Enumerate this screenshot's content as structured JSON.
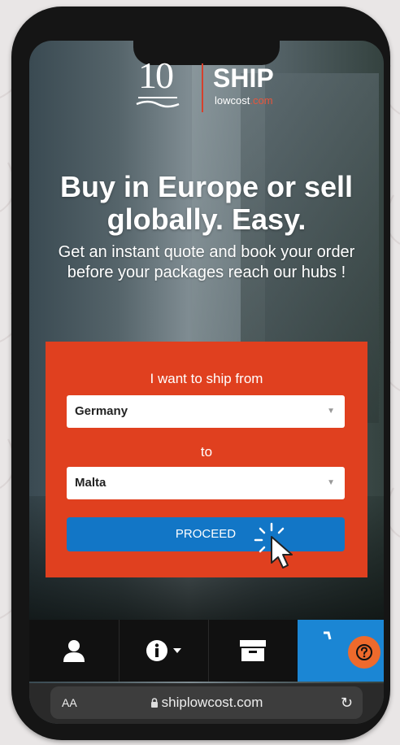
{
  "logo": {
    "anniversary": "10",
    "brand": "SHIP",
    "brand_sub": "lowcost",
    "brand_domain": ".com"
  },
  "hero": {
    "headline_line1": "Buy in Europe or sell",
    "headline_line2": "globally. Easy.",
    "subtext": "Get an instant quote and book your order before your packages reach our hubs !"
  },
  "form": {
    "ship_from_label": "I want to ship from",
    "origin_value": "Germany",
    "to_label": "to",
    "destination_value": "Malta",
    "proceed_label": "PROCEED",
    "accent_color": "#e0401f",
    "button_color": "#1276c6"
  },
  "navbar": {
    "items": [
      {
        "icon": "user-icon"
      },
      {
        "icon": "info-dropdown-icon"
      },
      {
        "icon": "archive-box-icon"
      },
      {
        "icon": "cart-icon"
      }
    ],
    "help_icon": "help-icon",
    "cart_color": "#1b86d4",
    "help_color": "#ee6a2c"
  },
  "browser": {
    "text_size_label": "AA",
    "url": "shiplowcost.com"
  }
}
